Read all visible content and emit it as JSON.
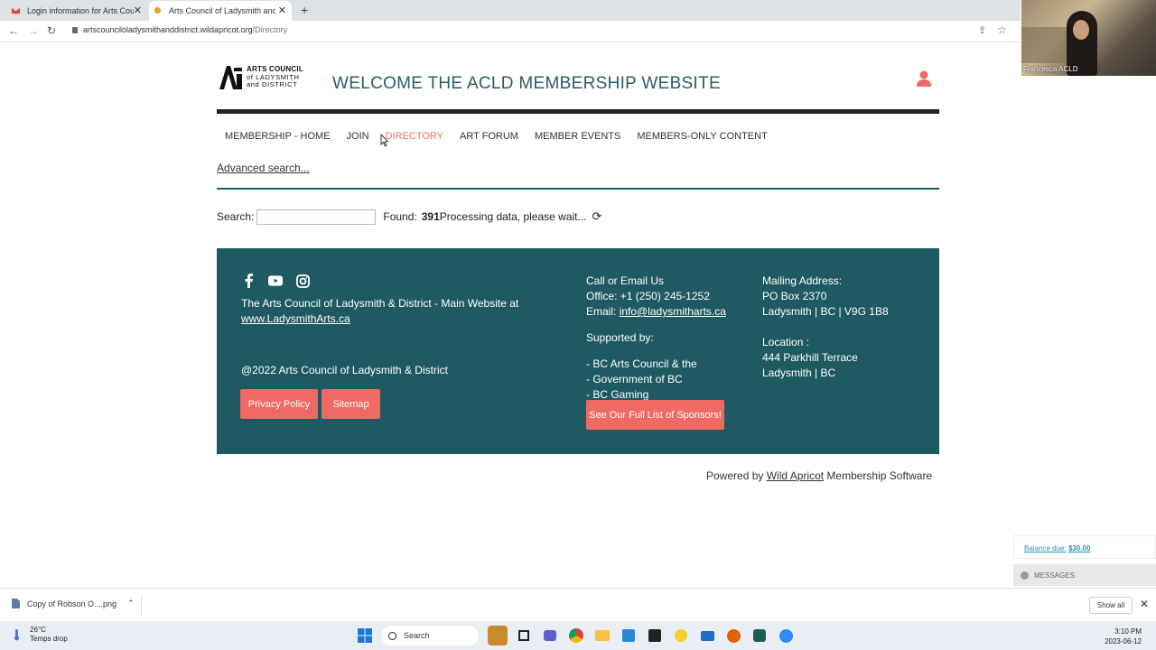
{
  "browser": {
    "tabs": [
      {
        "title": "Login information for Arts Counc",
        "favicon": "gmail-icon"
      },
      {
        "title": "Arts Council of Ladysmith and Di",
        "favicon": "site-icon"
      }
    ],
    "url_host": "artscounciloladysmithanddistrict.wildapricot.org",
    "url_path": "/Directory"
  },
  "video": {
    "participant_name": "Francesca ACLD"
  },
  "header": {
    "logo_line1": "ARTS COUNCIL",
    "logo_line2": "of LADYSMITH",
    "logo_line3": "and DISTRICT",
    "welcome": "WELCOME THE ACLD MEMBERSHIP WEBSITE"
  },
  "menu": [
    "MEMBERSHIP - HOME",
    "JOIN",
    "DIRECTORY",
    "ART FORUM",
    "MEMBER EVENTS",
    "MEMBERS-ONLY CONTENT"
  ],
  "directory": {
    "advanced_link": "Advanced search...",
    "search_label": "Search:",
    "search_value": "",
    "found_label": "Found:",
    "found_count": "391",
    "status": "Processing data, please wait..."
  },
  "footer": {
    "main_site_text": "The Arts Council of Ladysmith & District - Main Website at",
    "main_site_link": "www.LadysmithArts.ca",
    "copyright": "@2022 Arts Council of Ladysmith & District",
    "privacy_btn": "Privacy Policy",
    "sitemap_btn": "Sitemap",
    "contact_heading": "Call or Email Us",
    "office": "Office: +1 (250) 245-1252",
    "email_label": "Email:",
    "email": "info@ladysmitharts.ca",
    "supported_heading": "Supported by:",
    "supporters": [
      "- BC Arts Council & the",
      "- Government of BC",
      "- BC Gaming"
    ],
    "sponsors_btn": "See Our Full List of Sponsors!",
    "mailing_heading": "Mailing Address:",
    "mailing_line1": "PO Box 2370",
    "mailing_line2": "Ladysmith | BC | V9G 1B8",
    "location_heading": "Location :",
    "location_line1": "444 Parkhill Terrace",
    "location_line2": "Ladysmith | BC"
  },
  "powered": {
    "prefix": "Powered by",
    "link": "Wild Apricot",
    "suffix": "Membership Software"
  },
  "widget": {
    "balance_label": "Balance due:",
    "balance_value": "$30.00",
    "messages": "MESSAGES"
  },
  "downloads": {
    "file": "Copy of Robson O....png",
    "show_all": "Show all"
  },
  "taskbar": {
    "temp": "26°C",
    "weather": "Temps drop",
    "search": "Search",
    "time": "3:10 PM",
    "date": "2023-06-12"
  },
  "colors": {
    "accent": "#ee6a62",
    "footer_bg": "#1f5962",
    "heading": "#2a5d63"
  }
}
